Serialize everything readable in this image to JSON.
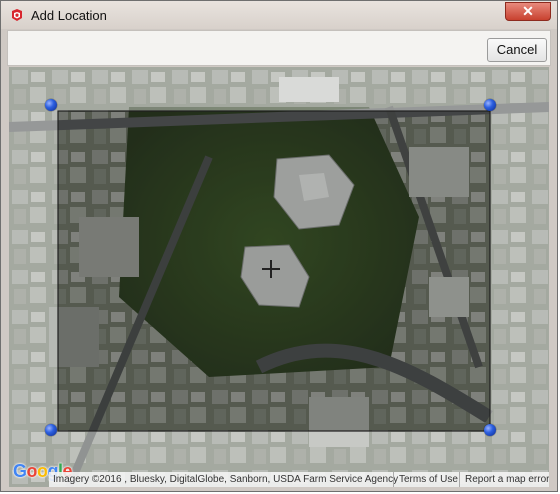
{
  "window": {
    "title": "Add Location",
    "close_symbol": "✕"
  },
  "toolbar": {
    "cancel_label": "Cancel"
  },
  "map": {
    "logo_letters": [
      "G",
      "o",
      "o",
      "g",
      "l",
      "e"
    ],
    "logo_colors": [
      "#4285f4",
      "#ea4335",
      "#fbbc05",
      "#4285f4",
      "#34a853",
      "#ea4335"
    ],
    "imagery_credit": "Imagery ©2016 , Bluesky, DigitalGlobe, Sanborn, USDA Farm Service Agency",
    "terms_label": "Terms of Use",
    "report_label": "Report a map error"
  },
  "colors": {
    "handle": "#2c5fe0",
    "close_button": "#c8412f"
  }
}
